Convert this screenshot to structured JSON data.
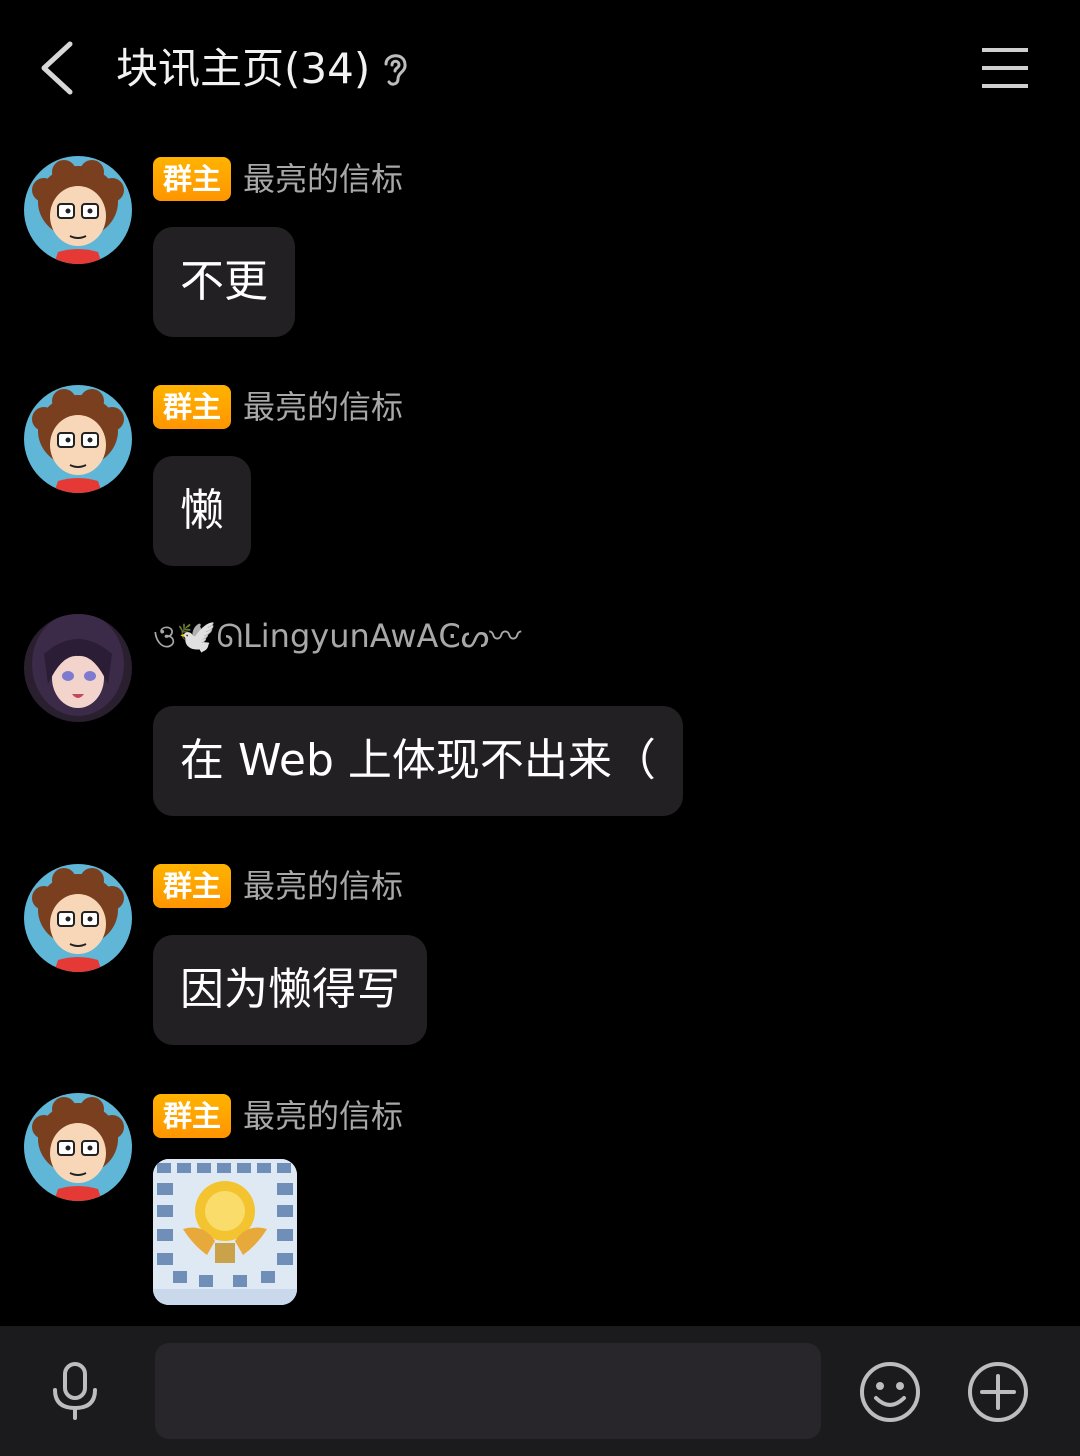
{
  "header": {
    "title": "块讯主页(34)",
    "back_icon": "chevron-left-icon",
    "ear_icon": "ear-icon",
    "menu_icon": "hamburger-menu-icon"
  },
  "colors": {
    "background": "#000000",
    "bubble": "#232024",
    "badge": "#ff9f00",
    "input_bar": "#1b1b1d"
  },
  "messages": [
    {
      "badge": "群主",
      "sender": "最亮的信标",
      "text": "不更"
    },
    {
      "badge": "群主",
      "sender": "最亮的信标",
      "text": "懒"
    },
    {
      "badge": "",
      "sender": "ও🕊️ᘏLingyunAwAϾ⁠ᔕ⁠〰",
      "text": "在 Web 上体现不出来（"
    },
    {
      "badge": "群主",
      "sender": "最亮的信标",
      "text": "因为懒得写"
    },
    {
      "badge": "群主",
      "sender": "最亮的信标",
      "text": "",
      "image": "sticker-image"
    }
  ],
  "input_bar": {
    "placeholder": "",
    "mic_icon": "microphone-icon",
    "emoji_icon": "smiley-icon",
    "plus_icon": "plus-circle-icon"
  }
}
